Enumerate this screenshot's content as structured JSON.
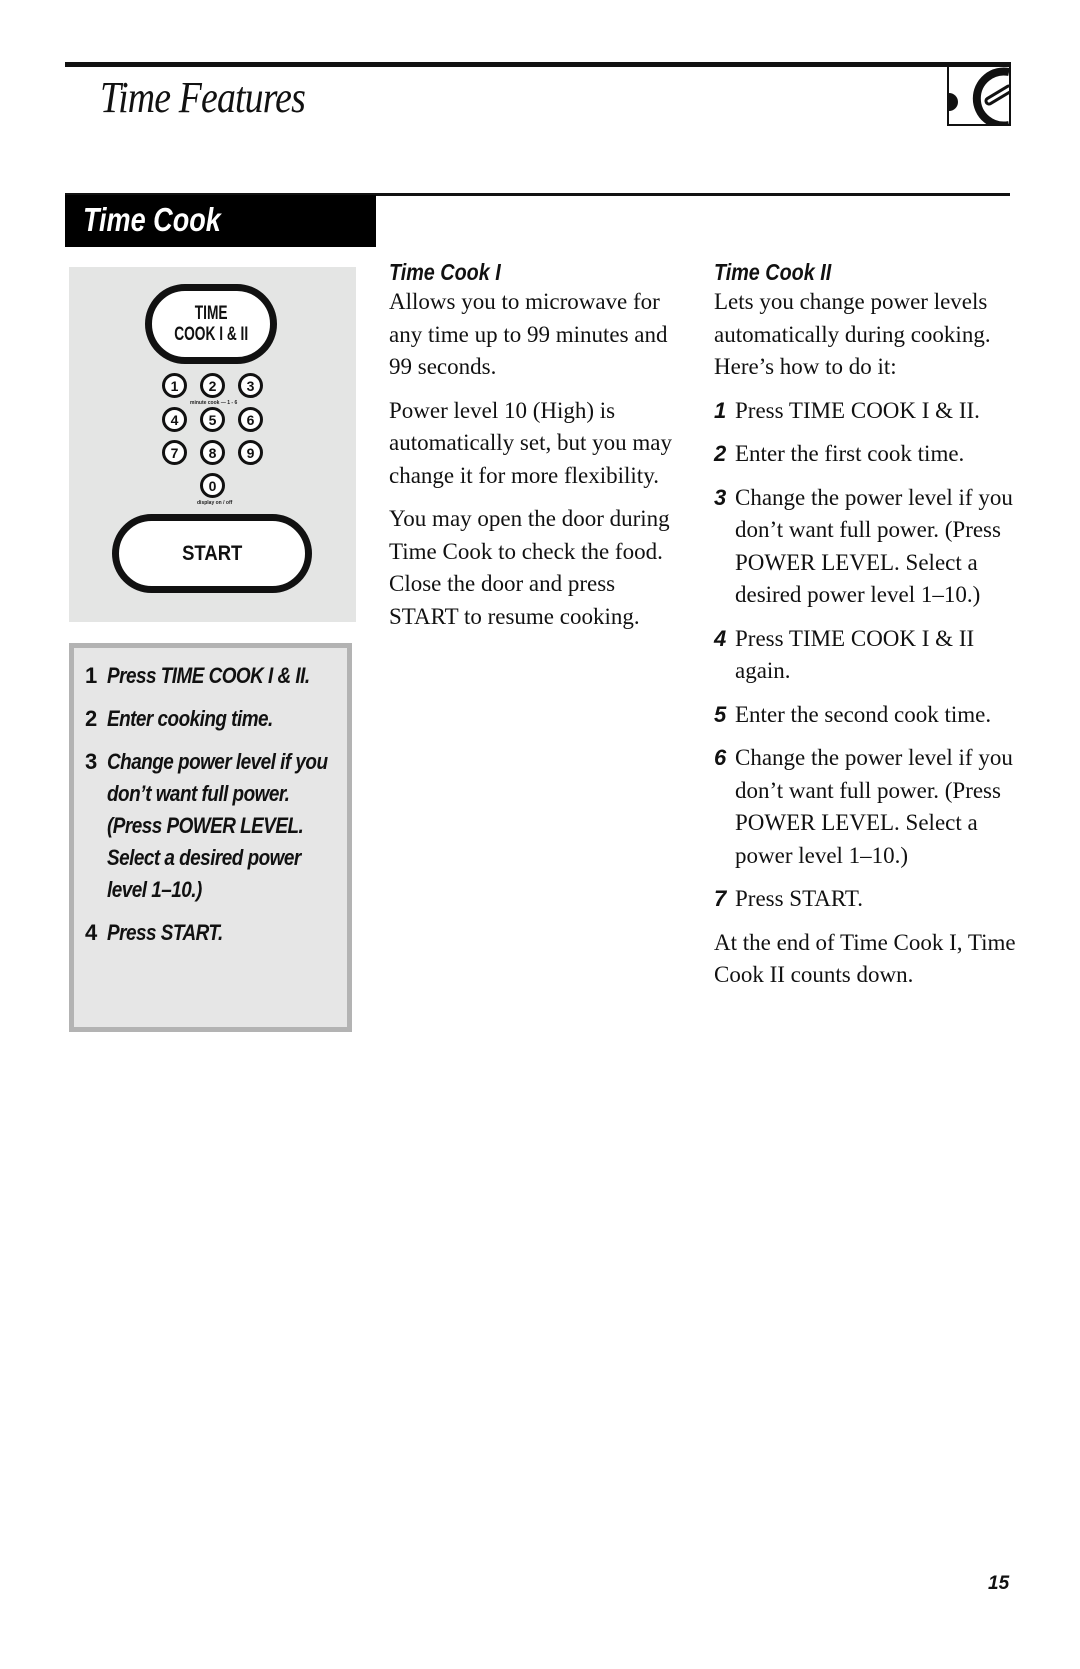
{
  "header": {
    "title": "Time Features",
    "chapter_icon": "timer-dial-icon"
  },
  "section": {
    "title": "Time Cook"
  },
  "keypad": {
    "time_cook_button": [
      "TIME",
      "COOK I & II"
    ],
    "number_keys": [
      "1",
      "2",
      "3",
      "4",
      "5",
      "6",
      "7",
      "8",
      "9",
      "0"
    ],
    "minute_cook_label": "minute cook — 1 - 6",
    "display_label": "display on / off",
    "start_button": "START"
  },
  "quick_steps": [
    {
      "num": "1",
      "text": "Press TIME COOK I & II."
    },
    {
      "num": "2",
      "text": "Enter cooking time."
    },
    {
      "num": "3",
      "text": "Change power level if you don’t want full power. (Press POWER LEVEL. Select a desired power level 1–10.)"
    },
    {
      "num": "4",
      "text": "Press START."
    }
  ],
  "time_cook_1": {
    "heading": "Time Cook I",
    "paragraphs": [
      "Allows you to microwave for any time up to 99 minutes and 99 seconds.",
      "Power level 10 (High) is automatically set, but you may change it for more flexibility.",
      "You may open the door during Time Cook to check the food. Close the door and press START to resume cooking."
    ]
  },
  "time_cook_2": {
    "heading": "Time Cook II",
    "intro": "Lets you change power levels automatically during cooking. Here’s how to do it:",
    "steps": [
      {
        "num": "1",
        "text": "Press TIME COOK I & II."
      },
      {
        "num": "2",
        "text": "Enter the first cook time."
      },
      {
        "num": "3",
        "text": "Change the power level if you don’t want full power. (Press POWER LEVEL. Select a desired power level 1–10.)"
      },
      {
        "num": "4",
        "text": "Press TIME COOK I & II again."
      },
      {
        "num": "5",
        "text": "Enter the second cook time."
      },
      {
        "num": "6",
        "text": "Change the power level if you don’t want full power. (Press POWER LEVEL. Select a power level 1–10.)"
      },
      {
        "num": "7",
        "text": "Press START."
      }
    ],
    "outro": "At the end of Time Cook I, Time Cook II counts down."
  },
  "footer": {
    "page_number": "15"
  }
}
